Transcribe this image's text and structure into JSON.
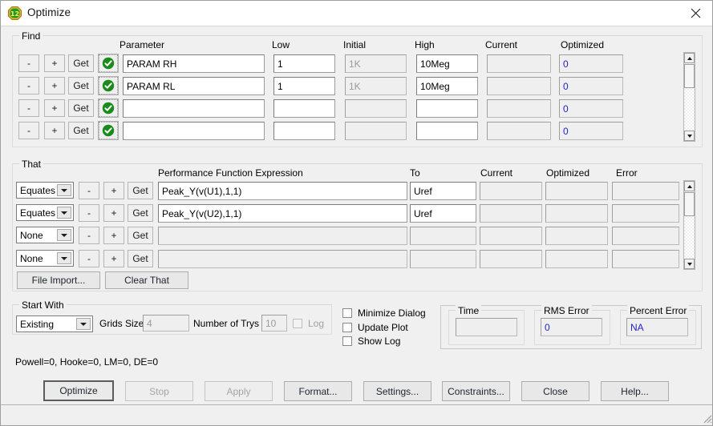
{
  "window": {
    "title": "Optimize",
    "icon": "optimize-12-icon",
    "icon_text": "12",
    "close_icon": "close-icon"
  },
  "find": {
    "legend": "Find",
    "headers": {
      "parameter": "Parameter",
      "low": "Low",
      "initial": "Initial",
      "high": "High",
      "current": "Current",
      "optimized": "Optimized"
    },
    "row_buttons": {
      "minus": "-",
      "plus": "+",
      "get": "Get",
      "enabled_icon": "check-circle-icon"
    },
    "rows": [
      {
        "parameter": "PARAM RH",
        "low": "1",
        "initial": "1K",
        "high": "10Meg",
        "current": "",
        "optimized": "0"
      },
      {
        "parameter": "PARAM RL",
        "low": "1",
        "initial": "1K",
        "high": "10Meg",
        "current": "",
        "optimized": "0"
      },
      {
        "parameter": "",
        "low": "",
        "initial": "",
        "high": "",
        "current": "",
        "optimized": "0"
      },
      {
        "parameter": "",
        "low": "",
        "initial": "",
        "high": "",
        "current": "",
        "optimized": "0"
      }
    ]
  },
  "that": {
    "legend": "That",
    "headers": {
      "expression": "Performance Function Expression",
      "to": "To",
      "current": "Current",
      "optimized": "Optimized",
      "error": "Error"
    },
    "row_buttons": {
      "minus": "-",
      "plus": "+",
      "get": "Get"
    },
    "rows": [
      {
        "mode": "Equates",
        "expression": "Peak_Y(v(U1),1,1)",
        "to": "Uref",
        "current": "",
        "optimized": "",
        "error": ""
      },
      {
        "mode": "Equates",
        "expression": "Peak_Y(v(U2),1,1)",
        "to": "Uref",
        "current": "",
        "optimized": "",
        "error": ""
      },
      {
        "mode": "None",
        "expression": "",
        "to": "",
        "current": "",
        "optimized": "",
        "error": ""
      },
      {
        "mode": "None",
        "expression": "",
        "to": "",
        "current": "",
        "optimized": "",
        "error": ""
      }
    ],
    "file_import_label": "File Import...",
    "clear_that_label": "Clear That"
  },
  "start_with": {
    "legend": "Start With",
    "mode": "Existing",
    "grids_size_label": "Grids Size",
    "grids_size_value": "4",
    "number_of_trys_label": "Number of Trys",
    "number_of_trys_value": "10",
    "log_label": "Log"
  },
  "options": {
    "minimize_dialog": "Minimize Dialog",
    "update_plot": "Update Plot",
    "show_log": "Show Log"
  },
  "results": {
    "time_label": "Time",
    "time_value": "",
    "rms_error_label": "RMS Error",
    "rms_error_value": "0",
    "percent_error_label": "Percent Error",
    "percent_error_value": "NA"
  },
  "status": {
    "counters": "Powell=0, Hooke=0, LM=0, DE=0"
  },
  "buttons": {
    "optimize": "Optimize",
    "stop": "Stop",
    "apply": "Apply",
    "format": "Format...",
    "settings": "Settings...",
    "constraints": "Constraints...",
    "close": "Close",
    "help": "Help..."
  },
  "colors": {
    "dialog_bg": "#f0f0f0",
    "value_blue": "#2222cc",
    "check_green": "#1a8a1a",
    "icon_gold": "#d9a21b"
  }
}
